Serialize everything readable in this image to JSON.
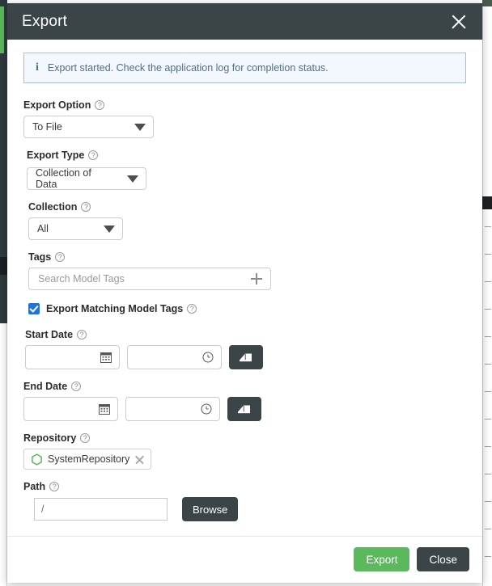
{
  "modal": {
    "title": "Export",
    "close_icon": "close-icon"
  },
  "alert": {
    "icon": "info-icon",
    "glyph": "i",
    "message": "Export started. Check the application log for completion status.",
    "bg_color": "#f2f8fd",
    "border_color": "#9dc4d8",
    "text_color": "#4f6f89"
  },
  "form": {
    "export_option": {
      "label": "Export Option",
      "help_glyph": "?",
      "value": "To File"
    },
    "export_type": {
      "label": "Export Type",
      "help_glyph": "?",
      "value": "Collection of Data"
    },
    "collection": {
      "label": "Collection",
      "help_glyph": "?",
      "value": "All"
    },
    "tags": {
      "label": "Tags",
      "help_glyph": "?",
      "placeholder": "Search Model Tags",
      "add_icon": "plus-icon"
    },
    "export_matching": {
      "label": "Export Matching Model Tags",
      "help_glyph": "?",
      "checked": true,
      "check_color": "#1a73e8"
    },
    "start_date": {
      "label": "Start Date",
      "help_glyph": "?",
      "date_value": "",
      "time_value": "",
      "date_icon": "calendar-icon",
      "time_icon": "clock-icon",
      "clear_icon": "eraser-icon"
    },
    "end_date": {
      "label": "End Date",
      "help_glyph": "?",
      "date_value": "",
      "time_value": "",
      "date_icon": "calendar-icon",
      "time_icon": "clock-icon",
      "clear_icon": "eraser-icon"
    },
    "repository": {
      "label": "Repository",
      "help_glyph": "?",
      "chip_label": "SystemRepository",
      "chip_icon": "hexagon-icon",
      "chip_icon_color": "#5cb85c",
      "remove_icon": "close-icon"
    },
    "path": {
      "label": "Path",
      "help_glyph": "?",
      "value": "/",
      "browse_label": "Browse"
    }
  },
  "footer": {
    "export_label": "Export",
    "close_label": "Close",
    "export_color": "#5cb85c",
    "close_color": "#3b4548"
  }
}
